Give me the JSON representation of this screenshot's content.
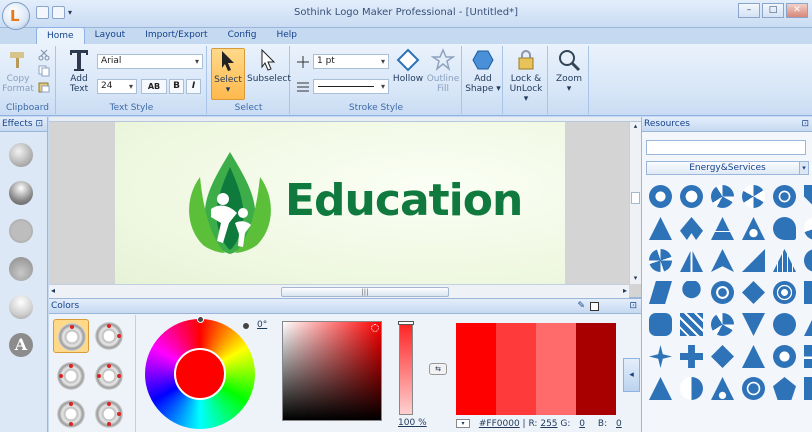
{
  "window": {
    "title": "Sothink Logo Maker Professional - [Untitled*]",
    "app_button_letter": "L",
    "controls": [
      "–",
      "□",
      "✕"
    ]
  },
  "tabs": [
    {
      "label": "Home",
      "active": true
    },
    {
      "label": "Layout",
      "active": false
    },
    {
      "label": "Import/Export",
      "active": false
    },
    {
      "label": "Config",
      "active": false
    },
    {
      "label": "Help",
      "active": false
    }
  ],
  "ribbon": {
    "clipboard": {
      "label": "Clipboard",
      "copy_format": "Copy Format"
    },
    "text_style": {
      "label": "Text Style",
      "add_text": "Add Text",
      "font": "Arial",
      "size": "24",
      "spacing_btn": "AB",
      "bold": "B",
      "italic": "I"
    },
    "select": {
      "label": "Select",
      "select": "Select",
      "subselect": "Subselect"
    },
    "stroke_style": {
      "label": "Stroke Style",
      "width": "1 pt",
      "hollow": "Hollow",
      "outline_fill": "Outline Fill"
    },
    "add_shape": "Add Shape",
    "lock_unlock": "Lock & UnLock",
    "zoom": "Zoom"
  },
  "effects": {
    "title": "Effects",
    "pin": "⊡",
    "text_effect_letter": "A"
  },
  "canvas": {
    "logo_text": "Education",
    "logo_color": "#107a3e",
    "scroll_grip": "|||"
  },
  "colors_panel": {
    "title": "Colors",
    "angle_value": "0°",
    "alpha_percent": "100",
    "percent_sign": "%",
    "hex": "#FF0000",
    "r_label": "R:",
    "r_value": "255",
    "g_label": "G:",
    "g_value": "0",
    "b_label": "B:",
    "b_value": "0",
    "shades": [
      "#ff0000",
      "#ff3a3a",
      "#ff6b6b",
      "#a80000"
    ]
  },
  "resources": {
    "title": "Resources",
    "search_placeholder": "",
    "category": "Energy&Services",
    "icon_color": "#2e72b8"
  }
}
